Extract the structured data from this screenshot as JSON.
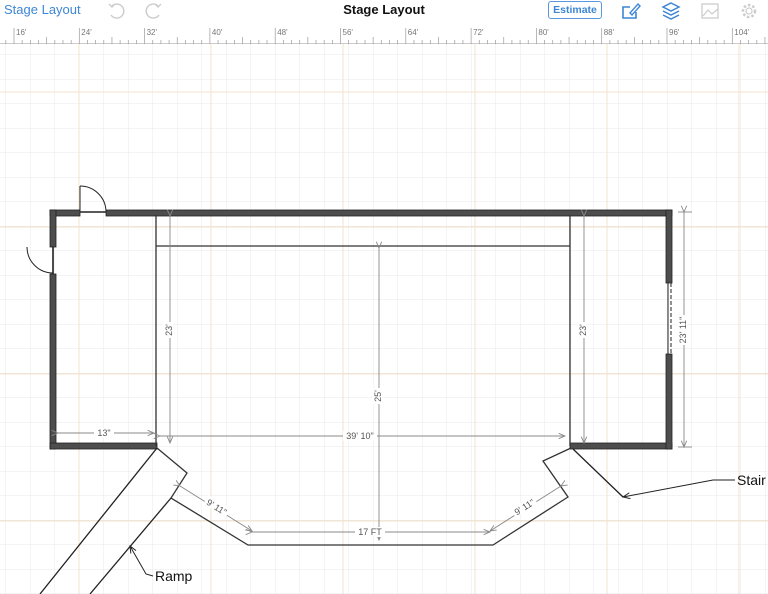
{
  "header": {
    "back_label": "Stage Layout",
    "title": "Stage Layout",
    "estimate_label": "Estimate"
  },
  "toolbar_icons": [
    "undo-icon",
    "redo-icon",
    "edit-icon",
    "layers-icon",
    "image-icon",
    "gear-icon"
  ],
  "ruler": {
    "labels": [
      "16'",
      "24'",
      "32'",
      "40'",
      "48'",
      "56'",
      "64'",
      "72'",
      "80'",
      "88'",
      "96'",
      "104'"
    ]
  },
  "drawing": {
    "dimensions": {
      "left_height": "23'",
      "center_height": "25'",
      "right_height": "23'",
      "outer_height": "23' 11\"",
      "left_offset": "13\"",
      "stage_width": "39' 10\"",
      "front_width": "17 FT",
      "left_angle": "9' 11\"",
      "right_angle": "9' 11\""
    },
    "labels": {
      "ramp": "Ramp",
      "stair": "Stair"
    }
  },
  "colors": {
    "accent": "#3d86d6",
    "wall": "#4d4d4d",
    "grid": "#e8e8e8",
    "grid_major": "#f3e3cc"
  }
}
